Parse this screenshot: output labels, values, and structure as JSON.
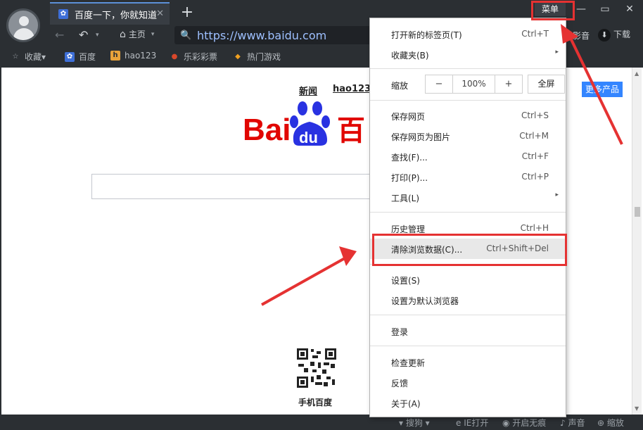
{
  "tab": {
    "title": "百度一下，你就知道",
    "close_glyph": "✕",
    "favicon_glyph": "✿"
  },
  "new_tab_glyph": "+",
  "window": {
    "menu_label": "菜单",
    "minimize": "—",
    "maximize": "▭",
    "close": "✕"
  },
  "toolbar": {
    "back": "←",
    "undo": "↶",
    "undo_caret": "▾",
    "home_glyph": "⌂",
    "home_label": "主页",
    "home_caret": "▾",
    "url": "https://www.baidu.com",
    "lock_glyph": "🔍",
    "video_label": "影音",
    "download_glyph": "⬇",
    "download_label": "下载"
  },
  "bookmarks": [
    {
      "label": "收藏▾",
      "icon": "star-icon",
      "glyph": "☆",
      "color": "#9aa0a6"
    },
    {
      "label": "百度",
      "icon": "baidu-paw-icon",
      "glyph": "✿",
      "color": "#3e6fd8"
    },
    {
      "label": "hao123",
      "icon": "hao123-icon",
      "glyph": "h",
      "color": "#e8a23a"
    },
    {
      "label": "乐彩彩票",
      "icon": "lottery-icon",
      "glyph": "●",
      "color": "#d9482b"
    },
    {
      "label": "热门游戏",
      "icon": "game-icon",
      "glyph": "◆",
      "color": "#f0a020"
    }
  ],
  "page": {
    "link_news": "新闻",
    "link_hao123": "hao123",
    "more_products": "更多产品",
    "logo_text_left": "Bai",
    "logo_text_mid": "du",
    "logo_text_right": "百",
    "qr_label": "手机百度"
  },
  "status": {
    "search_engine": "搜狗",
    "ie_open": "IE打开",
    "incognito": "开启无痕",
    "sound": "声音",
    "zoom": "缩放"
  },
  "menu": {
    "items_top": [
      {
        "label": "打开新的标签页(T)",
        "shortcut": "Ctrl+T",
        "submenu": false
      },
      {
        "label": "收藏夹(B)",
        "shortcut": "",
        "submenu": true
      }
    ],
    "zoom": {
      "label": "缩放",
      "minus": "−",
      "value": "100%",
      "plus": "+",
      "fullscreen": "全屏"
    },
    "items_page": [
      {
        "label": "保存网页",
        "shortcut": "Ctrl+S",
        "submenu": false
      },
      {
        "label": "保存网页为图片",
        "shortcut": "Ctrl+M",
        "submenu": false
      },
      {
        "label": "查找(F)...",
        "shortcut": "Ctrl+F",
        "submenu": false
      },
      {
        "label": "打印(P)...",
        "shortcut": "Ctrl+P",
        "submenu": false
      },
      {
        "label": "工具(L)",
        "shortcut": "",
        "submenu": true
      }
    ],
    "items_history": [
      {
        "label": "历史管理",
        "shortcut": "Ctrl+H",
        "submenu": false
      },
      {
        "label": "清除浏览数据(C)...",
        "shortcut": "Ctrl+Shift+Del",
        "submenu": false,
        "highlighted": true
      }
    ],
    "items_settings": [
      {
        "label": "设置(S)",
        "shortcut": ""
      },
      {
        "label": "设置为默认浏览器",
        "shortcut": ""
      }
    ],
    "login": "登录",
    "items_bottom": [
      {
        "label": "检查更新"
      },
      {
        "label": "反馈"
      },
      {
        "label": "关于(A)"
      }
    ],
    "submenu_arrow": "▸"
  },
  "colors": {
    "annotation_red": "#e53232",
    "chrome_dark": "#2b2f33",
    "baidu_red": "#e10601",
    "baidu_blue": "#2932e1",
    "link_blue": "#3385ff"
  }
}
